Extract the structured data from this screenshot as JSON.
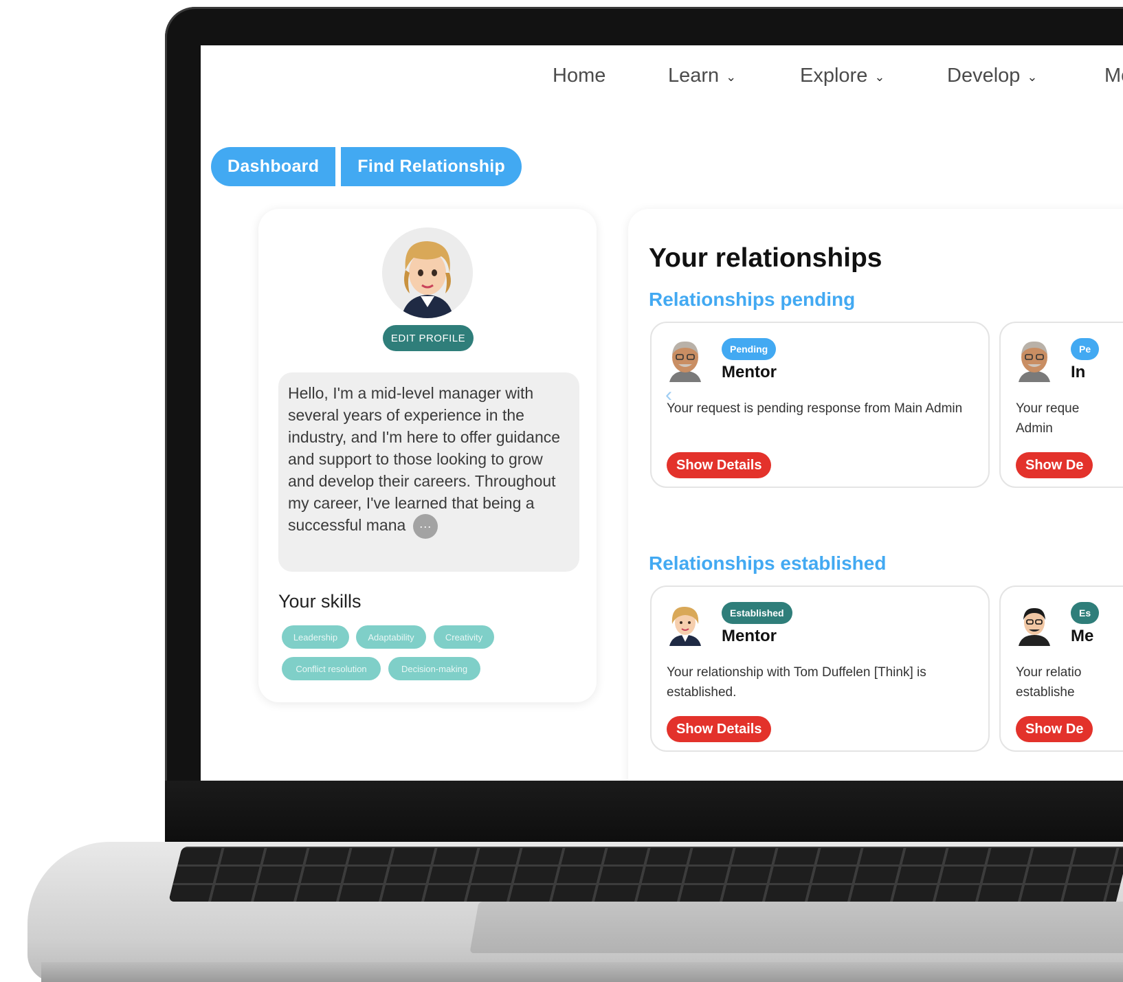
{
  "nav": {
    "home": "Home",
    "learn": "Learn",
    "explore": "Explore",
    "develop": "Develop",
    "more": "Mo"
  },
  "tabs": {
    "dashboard": "Dashboard",
    "find_relationship": "Find Relationship"
  },
  "profile": {
    "edit_label": "EDIT PROFILE",
    "bio": "Hello, I'm a mid-level manager with several years of experience in the industry, and I'm here to offer guidance and support to those looking to grow and develop their careers. Throughout my career, I've learned that being a successful mana",
    "more_glyph": "···",
    "skills_title": "Your skills",
    "skills": [
      "Leadership",
      "Adaptability",
      "Creativity",
      "Conflict resolution",
      "Decision-making"
    ]
  },
  "relationships": {
    "title": "Your relationships",
    "pending_title": "Relationships pending",
    "established_title": "Relationships established",
    "pending": [
      {
        "badge": "Pending",
        "role": "Mentor",
        "desc": "Your request is pending response from Main Admin",
        "button": "Show Details"
      },
      {
        "badge": "Pe",
        "role": "In",
        "desc": "Your reque Admin",
        "button": "Show De"
      }
    ],
    "established": [
      {
        "badge": "Established",
        "role": "Mentor",
        "desc": "Your relationship with Tom Duffelen [Think] is established.",
        "button": "Show Details"
      },
      {
        "badge": "Es",
        "role": "Me",
        "desc": "Your relatio establishe",
        "button": "Show De"
      }
    ]
  },
  "colors": {
    "accent_blue": "#42a9f2",
    "teal": "#2f7e7a",
    "skill_teal": "#7fcfc8",
    "danger_red": "#e3322b"
  }
}
